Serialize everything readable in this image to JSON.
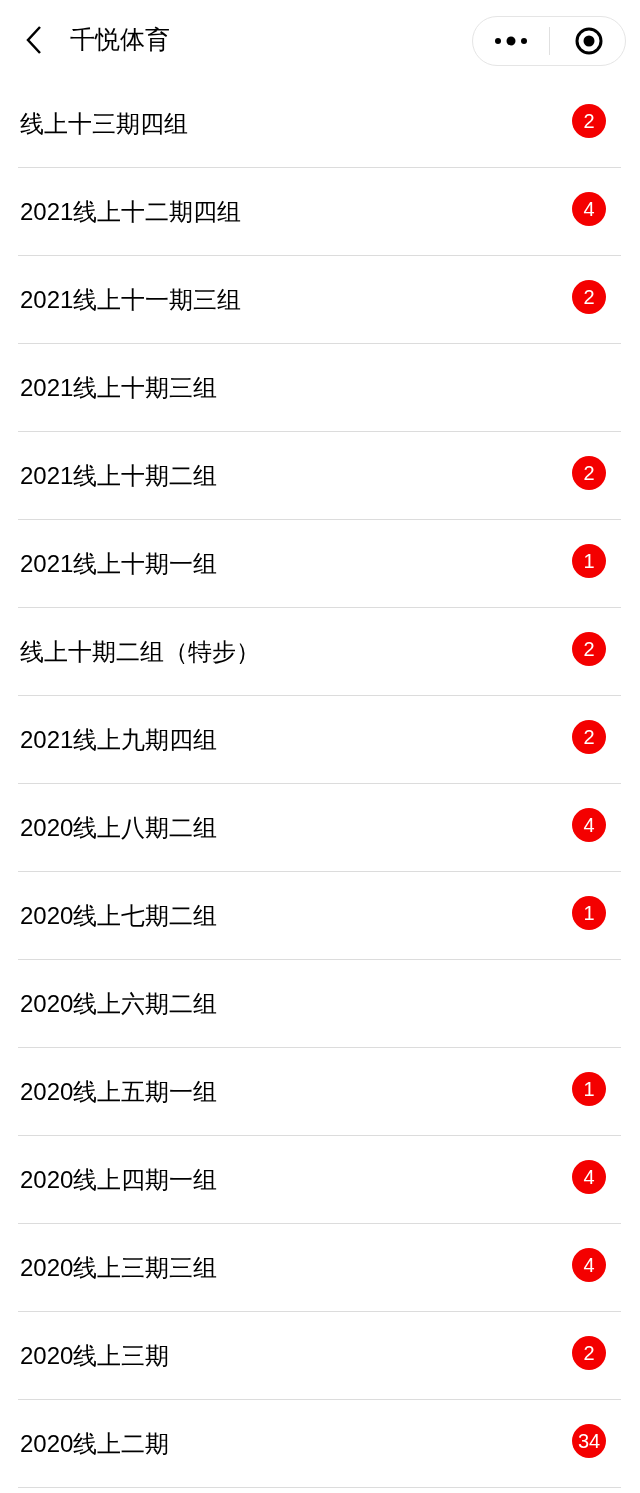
{
  "header": {
    "title": "千悦体育"
  },
  "rows": [
    {
      "name": "线上十三期四组",
      "badge": "2"
    },
    {
      "name": "2021线上十二期四组",
      "badge": "4"
    },
    {
      "name": "2021线上十一期三组",
      "badge": "2"
    },
    {
      "name": "2021线上十期三组"
    },
    {
      "name": "2021线上十期二组",
      "badge": "2"
    },
    {
      "name": "2021线上十期一组",
      "badge": "1"
    },
    {
      "name": "线上十期二组（特步）",
      "badge": "2"
    },
    {
      "name": "2021线上九期四组",
      "badge": "2"
    },
    {
      "name": "2020线上八期二组",
      "badge": "4"
    },
    {
      "name": "2020线上七期二组",
      "badge": "1"
    },
    {
      "name": "2020线上六期二组"
    },
    {
      "name": "2020线上五期一组",
      "badge": "1"
    },
    {
      "name": "2020线上四期一组",
      "badge": "4"
    },
    {
      "name": "2020线上三期三组",
      "badge": "4"
    },
    {
      "name": "2020线上三期",
      "badge": "2"
    },
    {
      "name": "2020线上二期",
      "badge": "34"
    }
  ]
}
